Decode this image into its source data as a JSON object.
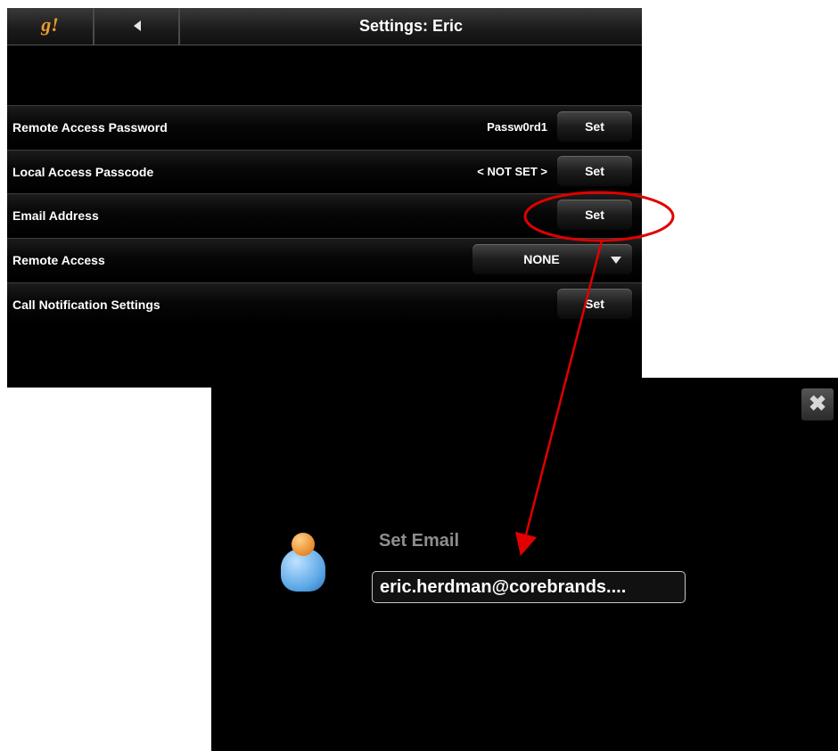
{
  "header": {
    "logo": "g!",
    "back_icon": "back-arrow-icon",
    "title": "Settings: Eric"
  },
  "settings": {
    "rows": [
      {
        "label": "Remote Access Password",
        "value": "Passw0rd1",
        "button": "Set"
      },
      {
        "label": "Local Access Passcode",
        "value": "< NOT SET >",
        "button": "Set"
      },
      {
        "label": "Email Address",
        "value": "",
        "button": "Set"
      },
      {
        "label": "Remote Access",
        "dropdown_value": "NONE"
      },
      {
        "label": "Call Notification Settings",
        "value": "",
        "button": "Set"
      }
    ]
  },
  "popup": {
    "close_icon": "close-icon",
    "user_icon": "user-icon",
    "title": "Set Email",
    "email_value": "eric.herdman@corebrands...."
  },
  "colors": {
    "annotation": "#e00000",
    "logo": "#e89b2c",
    "panel_bg": "#000000"
  }
}
